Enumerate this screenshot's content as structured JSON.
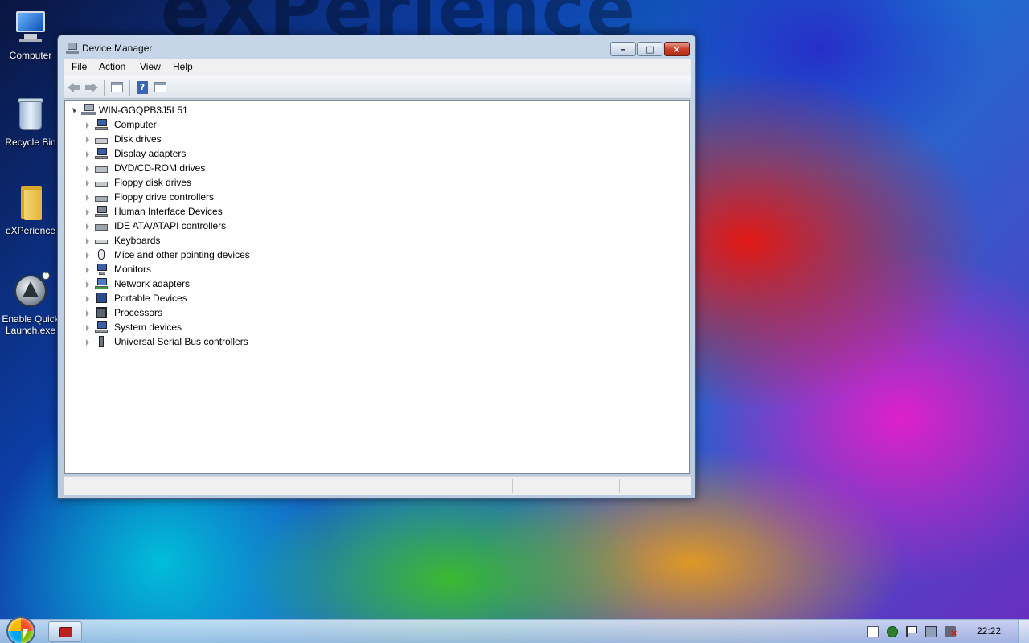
{
  "desktop": {
    "watermark": "eXPerience",
    "icons": [
      {
        "label": "Computer",
        "icon": "computer-icon"
      },
      {
        "label": "Recycle Bin",
        "icon": "recycle-bin-icon"
      },
      {
        "label": "eXPerience",
        "icon": "folder-icon"
      },
      {
        "label": "Enable Quick Launch.exe",
        "icon": "quick-launch-icon"
      }
    ]
  },
  "window": {
    "title": "Device Manager",
    "controls": {
      "minimize": "–",
      "maximize": "□",
      "close": "×"
    },
    "menu": [
      {
        "label": "File"
      },
      {
        "label": "Action"
      },
      {
        "label": "View"
      },
      {
        "label": "Help"
      }
    ],
    "toolbar": [
      "back-icon",
      "forward-icon",
      "show-hide-console-tree-icon",
      "help-icon",
      "properties-pane-icon"
    ],
    "tree": {
      "root": "WIN-GGQPB3J5L51",
      "items": [
        {
          "label": "Computer",
          "icon": "computer-icon"
        },
        {
          "label": "Disk drives",
          "icon": "disk-drive-icon"
        },
        {
          "label": "Display adapters",
          "icon": "display-adapter-icon"
        },
        {
          "label": "DVD/CD-ROM drives",
          "icon": "dvd-drive-icon"
        },
        {
          "label": "Floppy disk drives",
          "icon": "floppy-disk-icon"
        },
        {
          "label": "Floppy drive controllers",
          "icon": "floppy-controller-icon"
        },
        {
          "label": "Human Interface Devices",
          "icon": "hid-icon"
        },
        {
          "label": "IDE ATA/ATAPI controllers",
          "icon": "ide-controller-icon"
        },
        {
          "label": "Keyboards",
          "icon": "keyboard-icon"
        },
        {
          "label": "Mice and other pointing devices",
          "icon": "mouse-icon"
        },
        {
          "label": "Monitors",
          "icon": "monitor-icon"
        },
        {
          "label": "Network adapters",
          "icon": "network-adapter-icon"
        },
        {
          "label": "Portable Devices",
          "icon": "portable-device-icon"
        },
        {
          "label": "Processors",
          "icon": "processor-icon"
        },
        {
          "label": "System devices",
          "icon": "system-devices-icon"
        },
        {
          "label": "Universal Serial Bus controllers",
          "icon": "usb-icon"
        }
      ]
    }
  },
  "taskbar": {
    "clock": "22:22",
    "tray": [
      "document-icon",
      "network-icon",
      "action-center-flag-icon",
      "display-icon",
      "speaker-muted-icon"
    ]
  }
}
